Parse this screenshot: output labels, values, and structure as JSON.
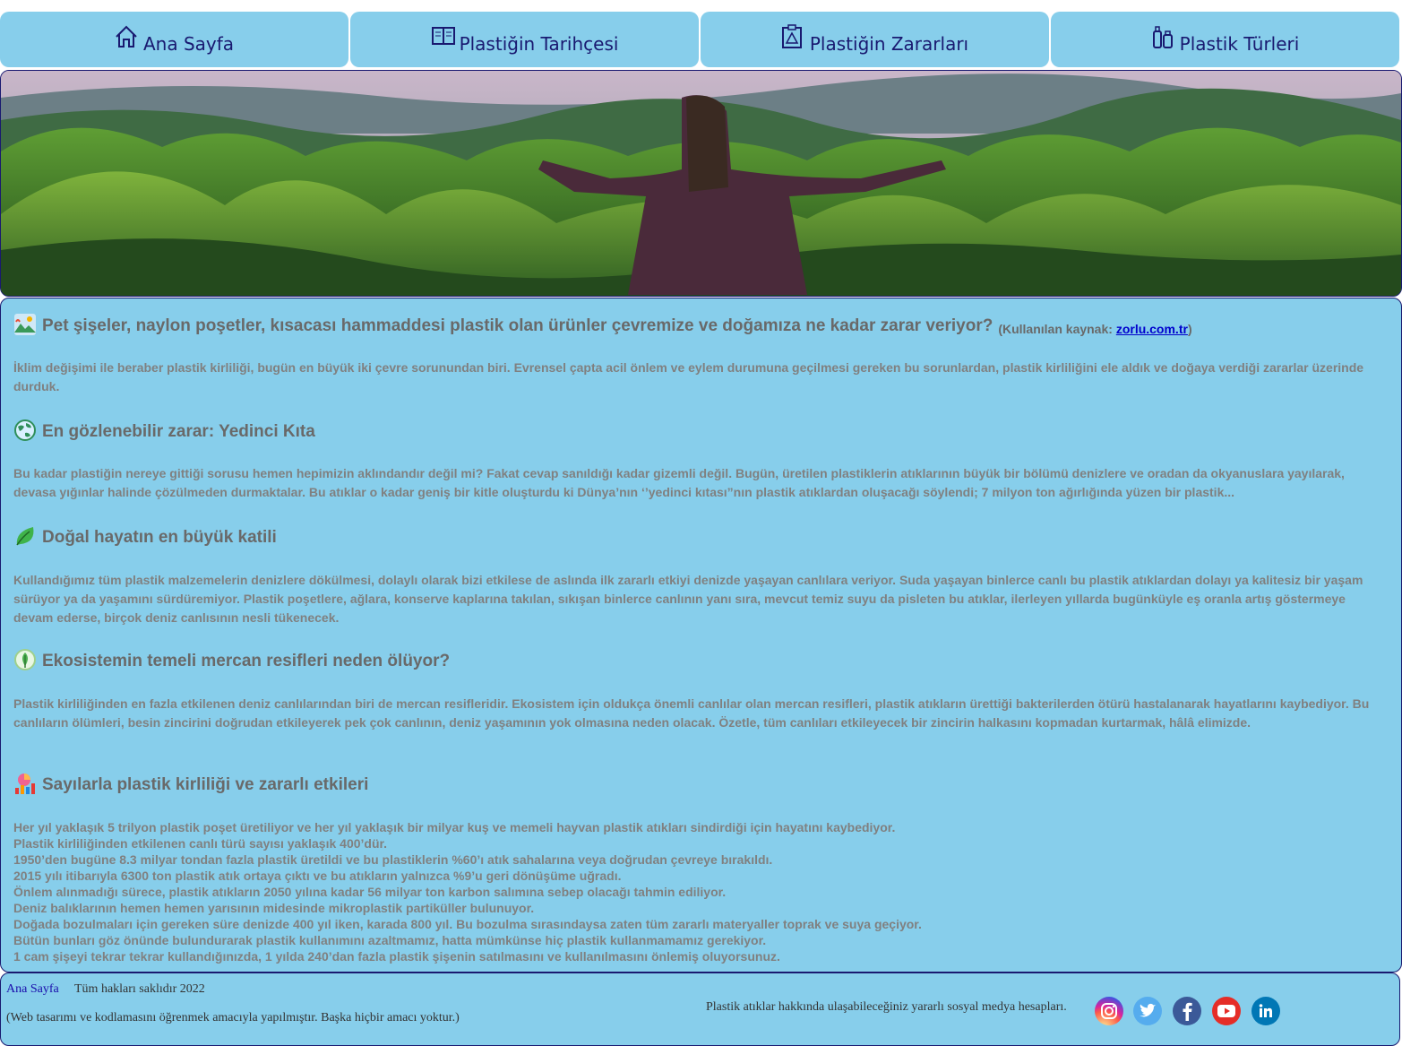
{
  "nav": [
    {
      "label": "Ana Sayfa",
      "icon": "home-icon"
    },
    {
      "label": "Plastiğin Tarihçesi",
      "icon": "book-icon"
    },
    {
      "label": "Plastiğin Zararları",
      "icon": "clipboard-warning-icon"
    },
    {
      "label": "Plastik Türleri",
      "icon": "bottles-icon"
    }
  ],
  "banner": {
    "description_icon": "landscape-photo"
  },
  "sections": [
    {
      "title": "Pet şişeler, naylon poşetler, kısacası hammaddesi plastik olan ürünler çevremize ve doğamıza ne kadar zarar veriyor?",
      "source_prefix": "(Kullanılan kaynak: ",
      "source_link": "zorlu.com.tr",
      "source_suffix": ")",
      "icon": "nature-scene-icon",
      "body": "İklim değişimi ile beraber plastik kirliliği, bugün en büyük iki çevre sorunundan biri. Evrensel çapta acil önlem ve eylem durumuna geçilmesi gereken bu sorunlardan, plastik kirliliğini ele aldık ve doğaya verdiği zararlar üzerinde durduk."
    },
    {
      "title": "En gözlenebilir zarar: Yedinci Kıta",
      "icon": "globe-icon",
      "body": "Bu kadar plastiğin nereye gittiği sorusu hemen hepimizin aklındandır değil mi? Fakat cevap sanıldığı kadar gizemli değil. Bugün, üretilen plastiklerin atıklarının büyük bir bölümü denizlere ve oradan da okyanuslara yayılarak, devasa yığınlar halinde çözülmeden durmaktalar. Bu atıklar o kadar geniş bir kitle oluşturdu ki Dünya’nın ‘’yedinci kıtası”nın plastik atıklardan oluşacağı söylendi; 7 milyon ton ağırlığında yüzen bir plastik..."
    },
    {
      "title": "Doğal hayatın en büyük katili",
      "icon": "leaf-icon",
      "body": "Kullandığımız tüm plastik malzemelerin denizlere dökülmesi, dolaylı olarak bizi etkilese de aslında ilk zararlı etkiyi denizde yaşayan canlılara veriyor. Suda yaşayan binlerce canlı bu plastik atıklardan dolayı ya kalitesiz bir yaşam sürüyor ya da yaşamını sürdüremiyor. Plastik poşetlere, ağlara, konserve kaplarına takılan, sıkışan binlerce canlının yanı sıra, mevcut temiz suyu da pisleten bu atıklar, ilerleyen yıllarda bugünküyle eş oranla artış göstermeye devam ederse, birçok deniz canlısının nesli tükenecek."
    },
    {
      "title": "Ekosistemin temeli mercan resifleri neden ölüyor?",
      "icon": "eco-leaf-icon",
      "body": "Plastik kirliliğinden en fazla etkilenen deniz canlılarından biri de mercan resifleridir. Ekosistem için oldukça önemli canlılar olan mercan resifleri, plastik atıkların ürettiği bakterilerden ötürü hastalanarak hayatlarını kaybediyor. Bu canlıların ölümleri, besin zincirini doğrudan etkileyerek pek çok canlının, deniz yaşamının yok olmasına neden olacak. Özetle, tüm canlıları etkileyecek bir zincirin halkasını kopmadan kurtarmak, hâlâ elimizde."
    },
    {
      "title": "Sayılarla plastik kirliliği ve zararlı etkileri",
      "icon": "chart-icon",
      "lines": [
        "Her yıl yaklaşık 5 trilyon plastik poşet üretiliyor ve her yıl yaklaşık bir milyar kuş ve memeli hayvan plastik atıkları sindirdiği için hayatını kaybediyor.",
        "Plastik kirliliğinden etkilenen canlı türü sayısı yaklaşık 400’dür.",
        "1950’den bugüne 8.3 milyar tondan fazla plastik üretildi ve bu plastiklerin %60’ı atık sahalarına veya doğrudan çevreye bırakıldı.",
        "2015 yılı itibarıyla 6300 ton plastik atık ortaya çıktı ve bu atıkların yalnızca %9’u geri dönüşüme uğradı.",
        "Önlem alınmadığı sürece, plastik atıkların 2050 yılına kadar 56 milyar ton karbon salımına sebep olacağı tahmin ediliyor.",
        "Deniz balıklarının hemen hemen yarısının midesinde mikroplastik partiküller bulunuyor.",
        "Doğada bozulmaları için gereken süre denizde 400 yıl iken, karada 800 yıl. Bu bozulma sırasındaysa zaten tüm zararlı materyaller toprak ve suya geçiyor.",
        "Bütün bunları göz önünde bulundurarak plastik kullanımını azaltmamız, hatta mümkünse hiç plastik kullanmamamız gerekiyor.",
        "1 cam şişeyi tekrar tekrar kullandığınızda, 1 yılda 240’dan fazla plastik şişenin satılmasını ve kullanılmasını önlemiş oluyorsunuz."
      ]
    }
  ],
  "footer": {
    "home_link": "Ana Sayfa",
    "copyright": "Tüm hakları saklıdır 2022",
    "note": "(Web tasarımı ve kodlamasını öğrenmek amacıyla yapılmıştır. Başka hiçbir amacı yoktur.)",
    "social_text": "Plastik atıklar hakkında ulaşabileceğiniz yararlı sosyal medya hesapları.",
    "social": [
      {
        "name": "instagram-icon",
        "color": "#d6249f"
      },
      {
        "name": "twitter-icon",
        "color": "#55acee"
      },
      {
        "name": "facebook-icon",
        "color": "#3b5998"
      },
      {
        "name": "youtube-icon",
        "color": "#e52d27"
      },
      {
        "name": "linkedin-icon",
        "color": "#0077b5"
      }
    ]
  }
}
